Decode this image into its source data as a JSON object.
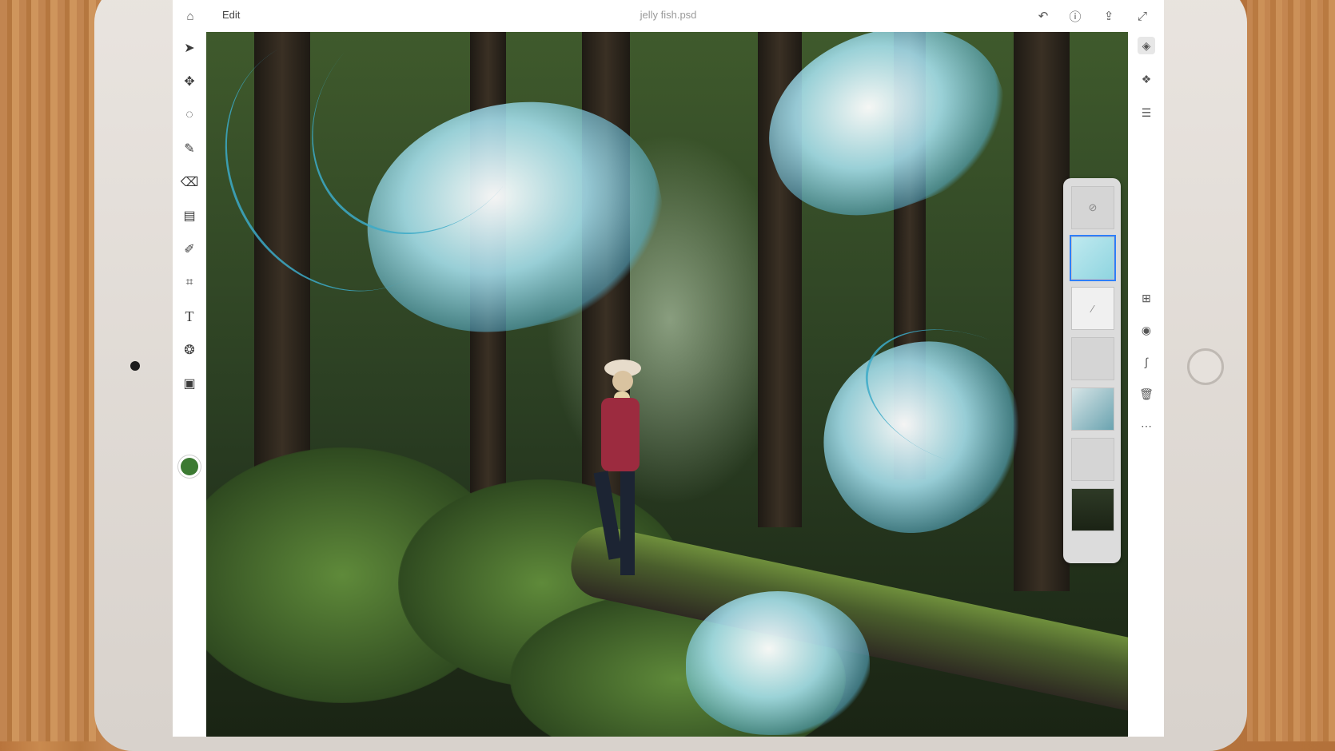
{
  "app": {
    "home_icon": "home-icon",
    "menu_label": "Edit",
    "document_title": "jelly fish.psd",
    "header_icons": [
      "undo-icon",
      "help-icon",
      "share-icon",
      "expand-icon"
    ]
  },
  "tools": [
    "select-icon",
    "move-icon",
    "lasso-icon",
    "brush-icon",
    "eraser-icon",
    "gradient-icon",
    "healing-icon",
    "crop-icon",
    "type-icon",
    "clone-icon",
    "image-icon"
  ],
  "type_tool_glyph": "T",
  "foreground_color": "#3c7a32",
  "right_rail": {
    "top_icons": [
      "layers-icon",
      "layer-properties-icon",
      "adjustments-icon"
    ],
    "bottom_icons": [
      "add-layer-icon",
      "visibility-icon",
      "link-icon",
      "delete-icon",
      "more-icon"
    ]
  },
  "layers": [
    {
      "name": "hidden-layer",
      "selected": false
    },
    {
      "name": "jellyfish-layer",
      "selected": true
    },
    {
      "name": "curves-adjustment-layer",
      "selected": false
    },
    {
      "name": "empty-layer",
      "selected": false
    },
    {
      "name": "jellyfish-cutout-layer",
      "selected": false
    },
    {
      "name": "blank-layer",
      "selected": false
    },
    {
      "name": "background-forest-layer",
      "selected": false
    }
  ]
}
